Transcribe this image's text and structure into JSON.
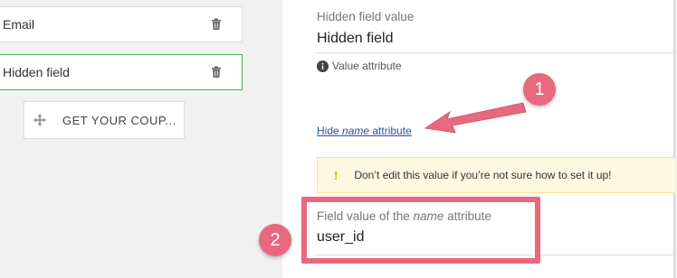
{
  "fields": {
    "email_label": "Email",
    "hidden_label": "Hidden field",
    "coupon_label": "GET YOUR COUP..."
  },
  "settings": {
    "value_label": "Hidden field value",
    "value": "Hidden field",
    "help_text": "Value attribute",
    "hide_link_prefix": "Hide ",
    "hide_link_em": "name",
    "hide_link_suffix": " attribute",
    "warning_icon": "!",
    "warning_text": "Don’t edit this value if you’re not sure how to set it up!",
    "name_label_prefix": "Field value of the ",
    "name_label_em": "name",
    "name_label_suffix": " attribute",
    "name_value": "user_id"
  },
  "annotations": {
    "callout_1": "1",
    "callout_2": "2",
    "color": "#e8697f"
  },
  "colors": {
    "selected_border": "#4caf50",
    "link": "#2b4fa3",
    "warning_bg": "#fff8e1",
    "warning_icon": "#e0a800"
  },
  "icons": [
    "trash-icon",
    "move-icon",
    "info-icon",
    "warning-icon",
    "arrow-icon"
  ]
}
